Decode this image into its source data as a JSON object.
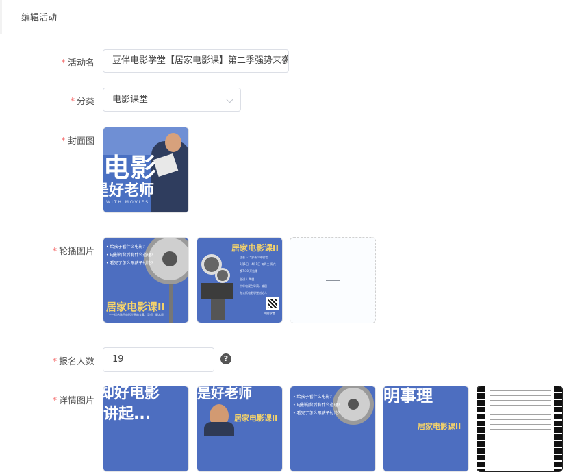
{
  "header": {
    "title": "编辑活动"
  },
  "form": {
    "name": {
      "label": "活动名",
      "value": "豆伴电影学堂【居家电影课】第二季强势来袭"
    },
    "category": {
      "label": "分类",
      "value": "电影课堂"
    },
    "cover": {
      "label": "封面图",
      "big_text_1": "电影",
      "big_text_2": "是好老师",
      "sub_text": "WITH MOVIES"
    },
    "carousel": {
      "label": "轮播图片",
      "img1": {
        "bullets": [
          "• 给孩子看什么电影?",
          "• 电影的背后有什么道理?",
          "• 看完了怎么跟孩子讨论?"
        ],
        "title": "居家电影课II",
        "sub": "——适合孩子电影世界的宝藏、导师、最本质"
      },
      "img2": {
        "title": "居家电影课II",
        "lines": [
          "适合7-15岁青少年收看",
          "3月1日—4月1日 每周三 周六",
          "晚7:30 开始播",
          "主讲人 陶桃",
          "中华电视台导演、编剧",
          "办公所电影学堂创始人"
        ],
        "qr_caption": "电影学堂"
      }
    },
    "signup": {
      "label": "报名人数",
      "value": "19",
      "help": "?"
    },
    "details": {
      "label": "详情图片",
      "img1_text": [
        "却好电影",
        "讲起..."
      ],
      "img2_text": [
        "是好老师",
        "居家电影课II"
      ],
      "img4_text": [
        "明事理",
        "居家电影课II"
      ]
    }
  },
  "colors": {
    "required": "#f56c6c",
    "poster_blue": "#4d6ec0",
    "poster_yellow": "#f5d36a"
  }
}
